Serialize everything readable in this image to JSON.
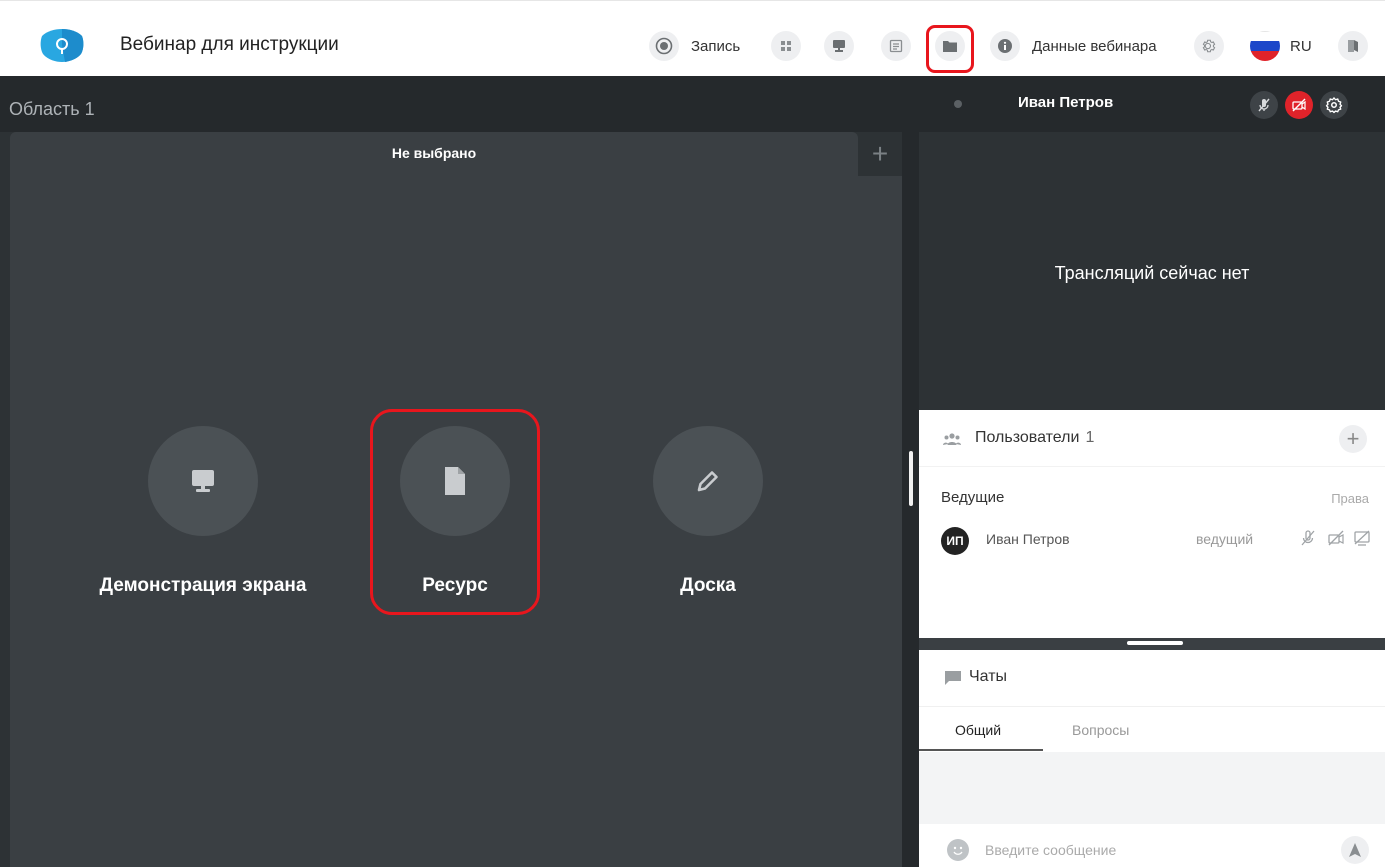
{
  "header": {
    "title": "Вебинар для инструкции",
    "record_label": "Запись",
    "webinar_data_label": "Данные вебинара",
    "language": "RU"
  },
  "area": {
    "title": "Область 1",
    "tab_label": "Не выбрано",
    "options": [
      {
        "label": "Демонстрация экрана",
        "icon": "monitor-icon"
      },
      {
        "label": "Ресурс",
        "icon": "document-icon"
      },
      {
        "label": "Доска",
        "icon": "pencil-icon"
      }
    ]
  },
  "video": {
    "presenter_name": "Иван Петров",
    "no_broadcast_text": "Трансляций сейчас нет"
  },
  "users": {
    "title": "Пользователи",
    "count": "1",
    "group_label": "Ведущие",
    "rights_label": "Права",
    "list": [
      {
        "initials": "ИП",
        "name": "Иван Петров",
        "role": "ведущий"
      }
    ]
  },
  "chat": {
    "title": "Чаты",
    "tabs": [
      "Общий",
      "Вопросы"
    ],
    "input_placeholder": "Введите сообщение"
  },
  "colors": {
    "highlight": "#e8161d",
    "dark_bg": "#2d3235",
    "accent_blue": "#29a7e1"
  }
}
